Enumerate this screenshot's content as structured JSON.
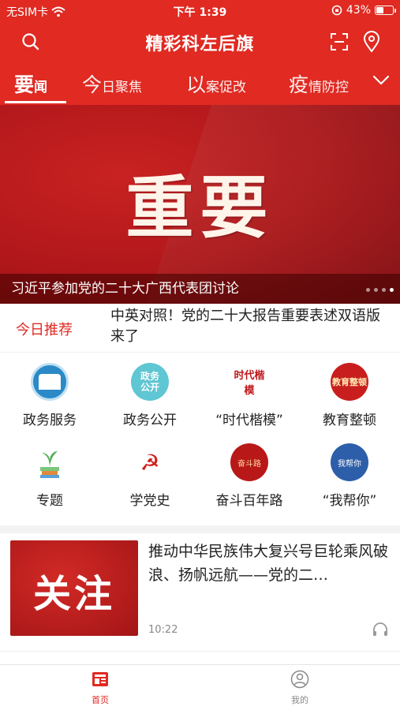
{
  "status_bar": {
    "carrier": "无SIM卡",
    "time": "下午 1:39",
    "battery": "43%",
    "battery_level": 0.43
  },
  "header": {
    "title": "精彩科左后旗"
  },
  "tabs": [
    {
      "big": "要",
      "small": "闻",
      "active": true
    },
    {
      "big": "今",
      "small": "日聚焦",
      "active": false
    },
    {
      "big": "以",
      "small": "案促改",
      "active": false
    },
    {
      "big": "疫",
      "small": "情防控",
      "active": false
    }
  ],
  "banner": {
    "big_text": "重要",
    "caption": "习近平参加党的二十大广西代表团讨论",
    "page_count": 4,
    "active_page": 4
  },
  "today": {
    "label": "今日推荐",
    "text": "中英对照！党的二十大报告重要表述双语版来了"
  },
  "grid": [
    {
      "label": "政务服务",
      "icon": "gov-service-icon"
    },
    {
      "label": "政务公开",
      "icon": "gov-public-icon",
      "icon_text": "政务公开"
    },
    {
      "label": "“时代楷模”",
      "icon": "model-icon",
      "icon_text": "时代楷模"
    },
    {
      "label": "教育整顿",
      "icon": "education-icon",
      "icon_text": "教育整顿"
    },
    {
      "label": "专题",
      "icon": "topic-icon"
    },
    {
      "label": "学党史",
      "icon": "party-history-icon",
      "icon_text": "☭"
    },
    {
      "label": "奋斗百年路",
      "icon": "strive-icon",
      "icon_text": "奋斗路"
    },
    {
      "label": "“我帮你”",
      "icon": "help-icon",
      "icon_text": "我帮你"
    }
  ],
  "article": {
    "thumb_text": "关注",
    "title": "推动中华民族伟大复兴号巨轮乘风破浪、扬帆远航——党的二…",
    "time": "10:22"
  },
  "bottom_nav": {
    "home": "首页",
    "mine": "我的"
  },
  "colors": {
    "brand": "#e02a22",
    "text": "#222222",
    "muted": "#888888"
  }
}
